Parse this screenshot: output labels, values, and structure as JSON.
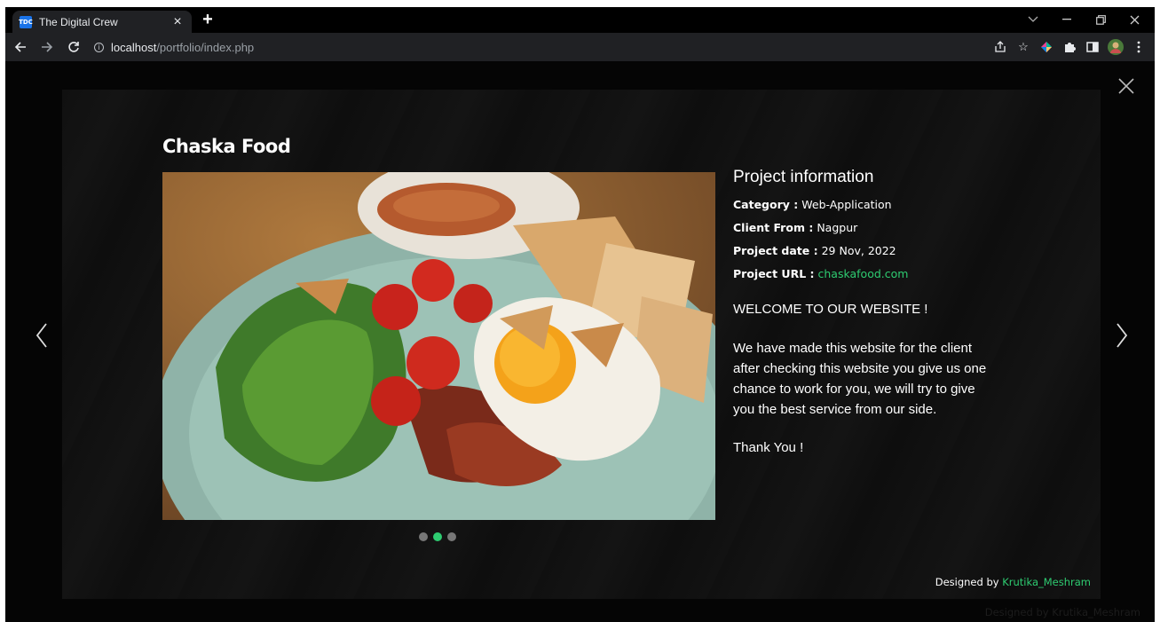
{
  "browser": {
    "tab_title": "The Digital Crew",
    "favicon_text": "TDC",
    "url_host": "localhost",
    "url_path": "/portfolio/index.php"
  },
  "project": {
    "title": "Chaska Food",
    "info_heading": "Project information",
    "category_label": "Category :",
    "category_value": "Web-Application",
    "client_label": "Client From :",
    "client_value": "Nagpur",
    "date_label": "Project date :",
    "date_value": "29 Nov, 2022",
    "url_label": "Project URL :",
    "url_value": "chaskafood.com",
    "welcome": "WELCOME TO OUR WEBSITE !",
    "description": "We have made this website for the client after checking this website you give us one chance to work for you, we will try to give you the best service from our side.",
    "thanks": "Thank You !"
  },
  "carousel": {
    "slides": 3,
    "active_index": 1
  },
  "footer": {
    "designed_by": "Designed by",
    "designer": "Krutika_Meshram"
  },
  "colors": {
    "accent": "#2ecc71",
    "background": "#050505"
  }
}
